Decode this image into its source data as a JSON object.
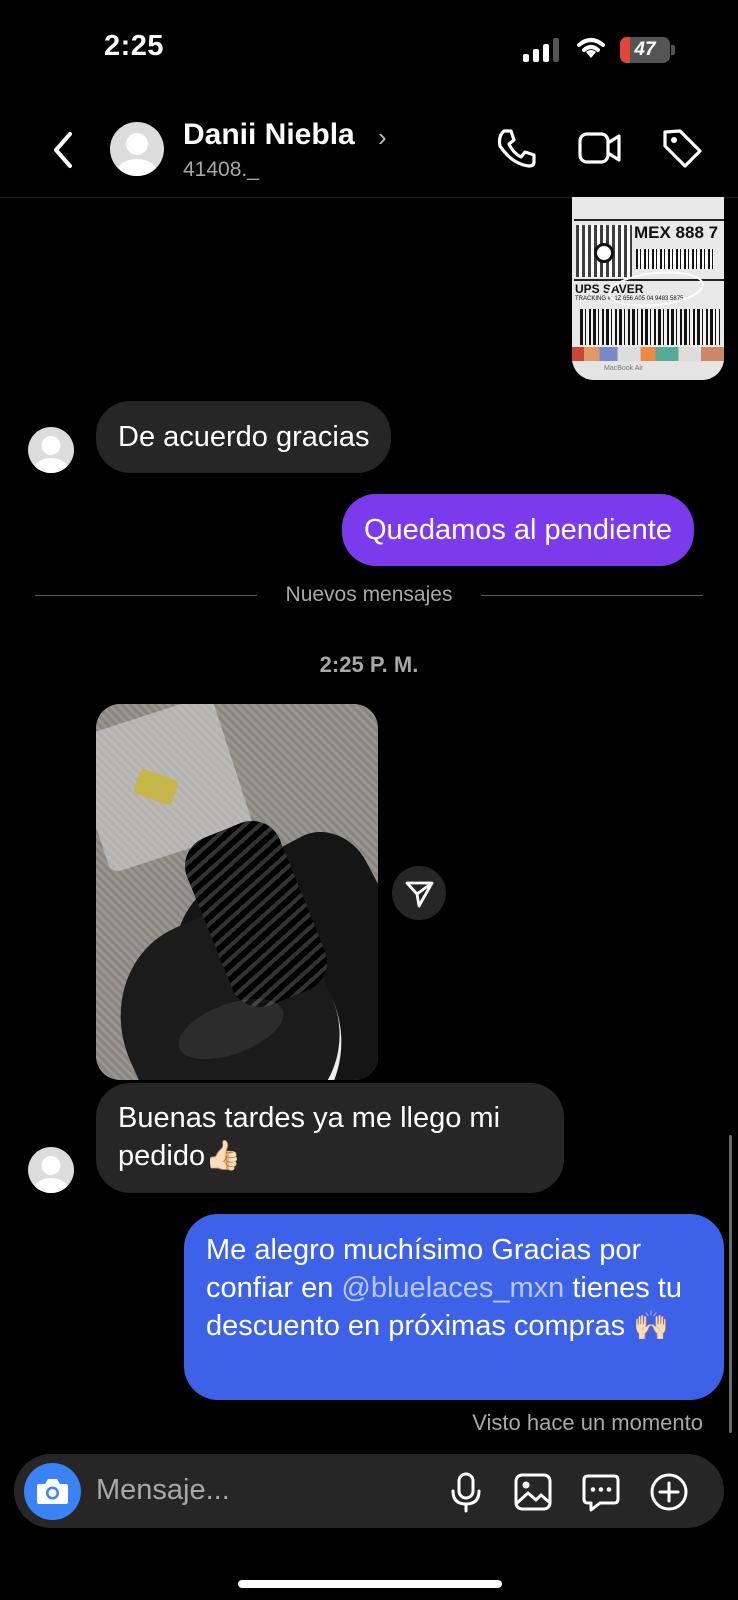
{
  "status_bar": {
    "time": "2:25",
    "battery_percent": "47",
    "battery_level": 0.2
  },
  "header": {
    "contact_name": "Danii Niebla",
    "username": "41408._",
    "icons": [
      "chevron-left-icon",
      "phone-icon",
      "video-call-icon",
      "tag-icon"
    ]
  },
  "conversation": {
    "label_image": {
      "mex_text": "MEX 888 7",
      "service_text": "UPS SAVER",
      "tracking_text": "TRACKING #: 1Z 656 A05 04 9483 5875",
      "device_text": "MacBook Air"
    },
    "messages": [
      {
        "from": "them",
        "text": "De acuerdo gracias"
      },
      {
        "from": "me",
        "text": "Quedamos al pendiente"
      }
    ],
    "new_messages_divider": "Nuevos mensajes",
    "timestamp": "2:25 P. M.",
    "later_messages": [
      {
        "from": "them",
        "text": "Buenas tardes ya me llego mi pedido👍🏻"
      },
      {
        "from": "me",
        "text_before": "Me alegro muchísimo Gracias por confiar en ",
        "mention": "@bluelaces_mxn",
        "text_after": " tienes tu descuento en próximas compras 🙌🏻"
      }
    ],
    "seen_status": "Visto hace un momento"
  },
  "composer": {
    "placeholder": "Mensaje...",
    "icons": [
      "camera-icon",
      "microphone-icon",
      "gallery-icon",
      "sticker-icon",
      "plus-icon"
    ]
  },
  "colors": {
    "background": "#000000",
    "incoming_bubble": "#262626",
    "outgoing_purple": "#7c3aed",
    "outgoing_blue": "#3d62e8",
    "camera_button": "#3b82f6"
  }
}
